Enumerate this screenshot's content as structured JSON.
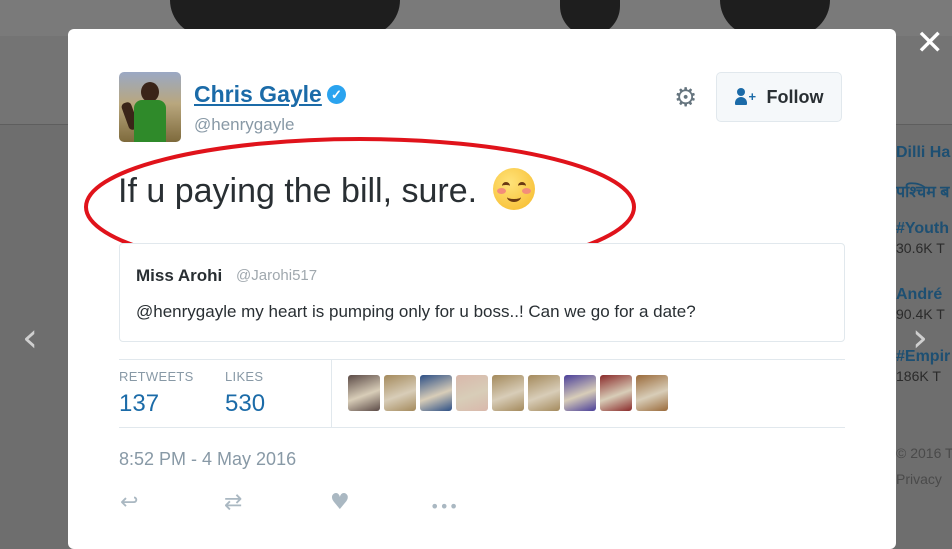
{
  "overlay": {
    "close_glyph": "✕",
    "prev_glyph": "‹",
    "next_glyph": "›"
  },
  "trends": [
    {
      "name": "Dilli Ha",
      "count": ""
    },
    {
      "name": "पश्चिम ब",
      "count": ""
    },
    {
      "name": "#Youth",
      "count": "30.6K T"
    },
    {
      "name": "André",
      "count": "90.4K T"
    },
    {
      "name": "#Empir",
      "count": "186K T"
    }
  ],
  "footer": {
    "copyright": "© 2016 T",
    "privacy": "Privacy"
  },
  "tweet": {
    "author": {
      "display_name": "Chris Gayle",
      "handle": "@henrygayle",
      "verified_glyph": "✓"
    },
    "follow_label": "Follow",
    "text": "If u paying the bill, sure.",
    "emoji": "smiling-face-with-blush",
    "quoted": {
      "name": "Miss Arohi",
      "handle": "@Jarohi517",
      "text": "@henrygayle my heart is pumping only for u boss..! Can we go for a date?"
    },
    "stats": {
      "retweets_label": "RETWEETS",
      "retweets_value": "137",
      "likes_label": "LIKES",
      "likes_value": "530"
    },
    "likers": [
      {
        "color": "#5b4a46"
      },
      {
        "color": "#a48a5c"
      },
      {
        "color": "#2c4f86"
      },
      {
        "color": "#d9b8ab"
      },
      {
        "color": "#a48a5c"
      },
      {
        "color": "#a48a5c"
      },
      {
        "color": "#4a3f9a"
      },
      {
        "color": "#8a2a2a"
      },
      {
        "color": "#9a6a3a"
      }
    ],
    "timestamp": "8:52 PM - 4 May 2016",
    "actions": {
      "reply_glyph": "↩",
      "retweet_glyph": "⇄",
      "like_glyph": "♥",
      "more_glyph": "•••"
    }
  },
  "colors": {
    "link": "#1b6ba8",
    "annotation": "#e0131b"
  }
}
